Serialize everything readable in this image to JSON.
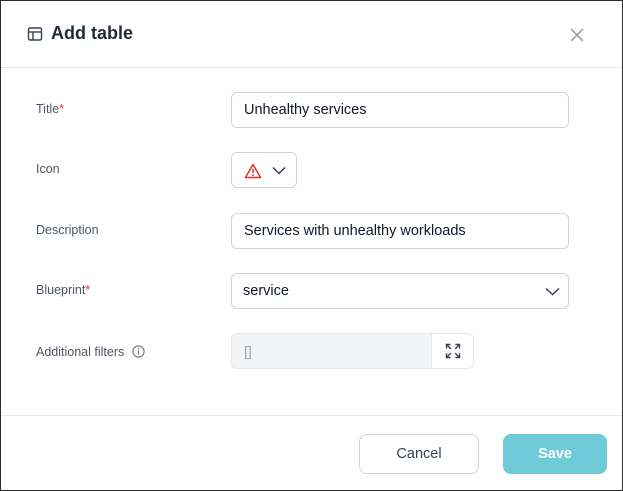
{
  "header": {
    "title": "Add table",
    "title_icon": "table-icon",
    "close_icon": "close-icon"
  },
  "form": {
    "title": {
      "label": "Title",
      "required_mark": "*",
      "value": "Unhealthy services"
    },
    "icon": {
      "label": "Icon",
      "selected_icon": "warning-icon",
      "icon_color": "#e03131"
    },
    "description": {
      "label": "Description",
      "value": "Services with unhealthy workloads"
    },
    "blueprint": {
      "label": "Blueprint",
      "required_mark": "*",
      "value": "service"
    },
    "additional_filters": {
      "label": "Additional filters",
      "info_icon": "info-icon",
      "value": "[]",
      "expand_icon": "expand-icon"
    }
  },
  "footer": {
    "cancel_label": "Cancel",
    "save_label": "Save"
  },
  "colors": {
    "accent": "#6fcbd8",
    "required": "#e03131"
  }
}
